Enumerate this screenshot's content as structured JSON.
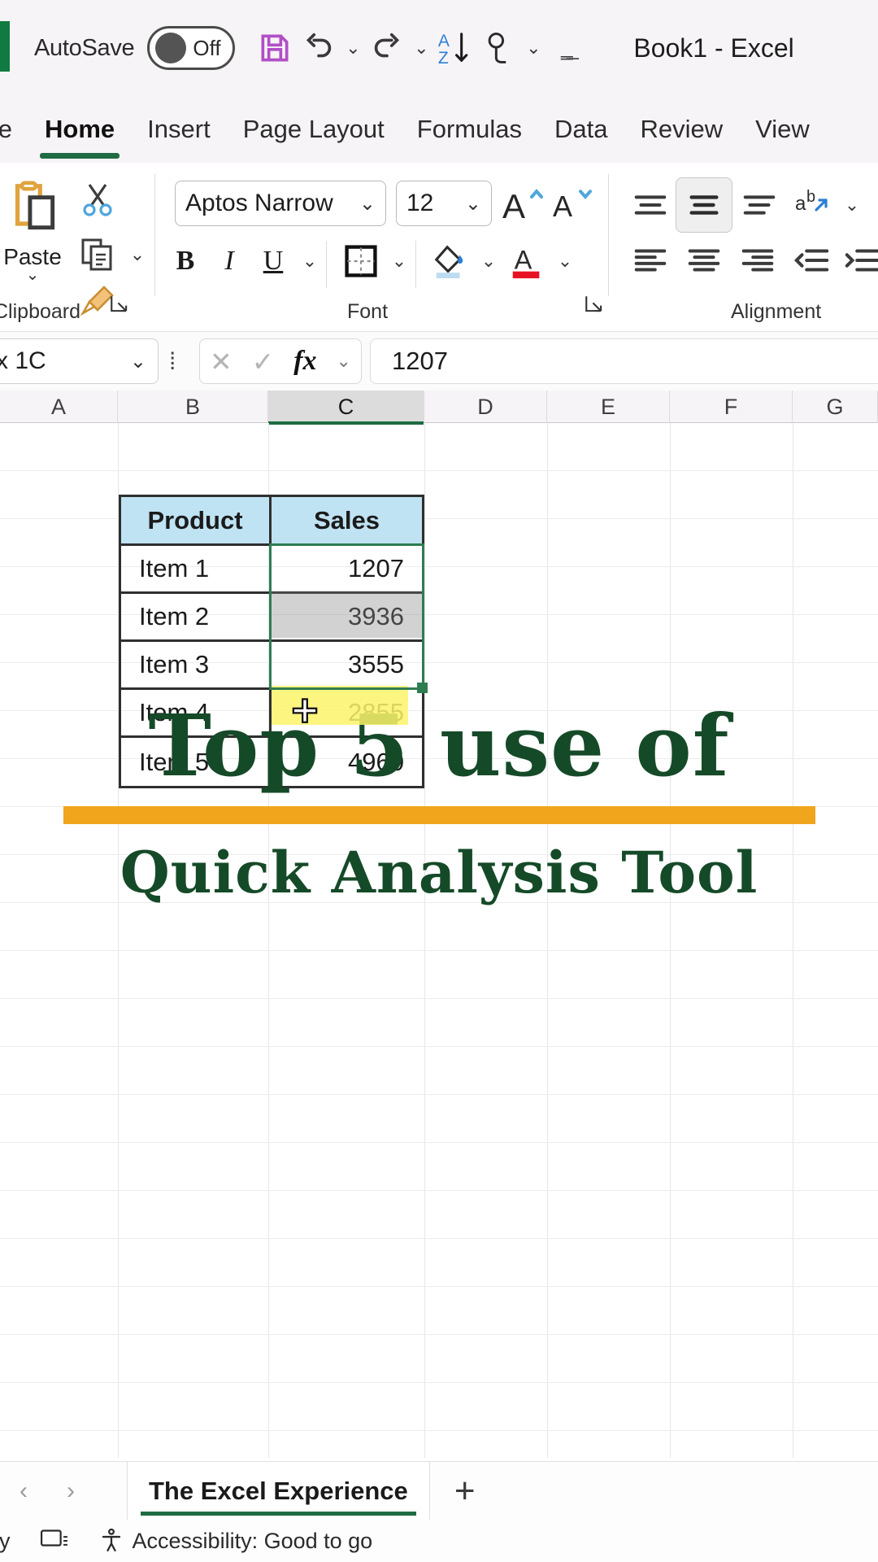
{
  "titlebar": {
    "autosave_label": "AutoSave",
    "autosave_state": "Off",
    "document_title": "Book1  -  Excel",
    "icons": [
      "save-icon",
      "undo-icon",
      "redo-icon",
      "sort-az-icon",
      "touch-mode-icon",
      "customize-qat-icon"
    ]
  },
  "tabs": [
    {
      "label": "ile",
      "active": false
    },
    {
      "label": "Home",
      "active": true
    },
    {
      "label": "Insert",
      "active": false
    },
    {
      "label": "Page Layout",
      "active": false
    },
    {
      "label": "Formulas",
      "active": false
    },
    {
      "label": "Data",
      "active": false
    },
    {
      "label": "Review",
      "active": false
    },
    {
      "label": "View",
      "active": false
    }
  ],
  "ribbon": {
    "clipboard": {
      "group_label": "Clipboard",
      "paste_label": "Paste",
      "buttons": [
        "cut-icon",
        "copy-icon",
        "format-painter-icon"
      ]
    },
    "font": {
      "group_label": "Font",
      "font_name": "Aptos Narrow",
      "font_size": "12",
      "bold": "B",
      "italic": "I",
      "underline": "U",
      "buttons": [
        "increase-font-size-icon",
        "decrease-font-size-icon",
        "borders-icon",
        "fill-color-icon",
        "font-color-icon"
      ]
    },
    "alignment": {
      "group_label": "Alignment",
      "buttons": [
        "align-top-icon",
        "align-middle-icon",
        "align-bottom-icon",
        "orientation-icon",
        "align-left-icon",
        "align-center-icon",
        "align-right-icon",
        "decrease-indent-icon",
        "increase-indent-icon"
      ]
    }
  },
  "formulabar": {
    "name_box": "x 1C",
    "cancel_icon": "cancel-icon",
    "enter_icon": "enter-icon",
    "fx_icon": "insert-function-icon",
    "value": "1207"
  },
  "grid": {
    "columns": [
      "A",
      "B",
      "C",
      "D",
      "E",
      "F",
      "G"
    ],
    "selected_column": "C"
  },
  "sheet_table": {
    "headers": [
      "Product",
      "Sales"
    ],
    "rows": [
      {
        "product": "Item 1",
        "sales": "1207"
      },
      {
        "product": "Item 2",
        "sales": "3936"
      },
      {
        "product": "Item 3",
        "sales": "3555"
      },
      {
        "product": "Item 4",
        "sales": "2855"
      },
      {
        "product": "Item 5",
        "sales": "4960"
      }
    ]
  },
  "overlay": {
    "line1": "Top 5 use of",
    "line2": "Quick Analysis Tool",
    "bar_color": "#f0a51c",
    "text_color": "#154a28"
  },
  "sheetbar": {
    "prev_label": "‹",
    "next_label": "›",
    "tabs": [
      "The Excel Experience"
    ],
    "add_label": "+"
  },
  "statusbar": {
    "ready": "dy",
    "display_settings_icon": "display-settings-icon",
    "accessibility_icon": "accessibility-icon",
    "accessibility_text": "Accessibility: Good to go"
  },
  "colors": {
    "excel_green": "#1f6b43",
    "header_fill": "#bfe3f2",
    "highlight_yellow": "#fbf36a",
    "selection_green": "#2e7d52"
  }
}
